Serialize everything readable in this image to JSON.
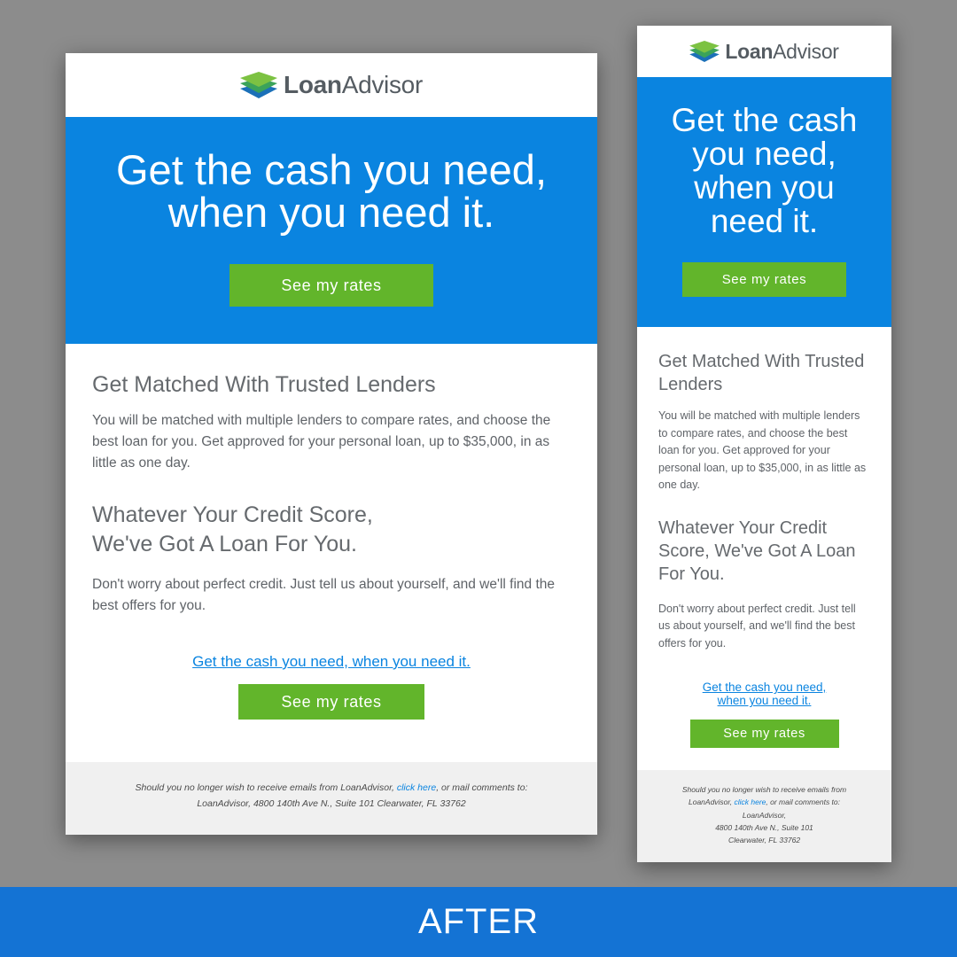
{
  "brand": {
    "logo_bold": "Loan",
    "logo_regular": "Advisor",
    "colors": {
      "primary_blue": "#0a84e0",
      "button_green": "#62b52b",
      "logo_dark": "#1b70b8",
      "logo_light": "#7cc242",
      "footer_bg": "#f0f0f0",
      "banner_blue": "#1473d4"
    }
  },
  "hero": {
    "title": "Get the cash you need, when you need it.",
    "button_label": "See my rates"
  },
  "sections": {
    "lenders_title": "Get Matched With Trusted Lenders",
    "lenders_text": "You will be matched with multiple lenders to compare rates, and choose the best loan for you. Get approved for your personal loan, up to $35,000, in as little as one day.",
    "credit_title_line1": "Whatever Your Credit Score,",
    "credit_title_line2": "We've Got A Loan For You.",
    "credit_title": "Whatever Your Credit Score, We've Got A Loan For You.",
    "credit_text": "Don't worry about perfect credit. Just tell us about yourself, and we'll find the best offers for you."
  },
  "cta": {
    "link_text": "Get the cash you need, when you need it.",
    "button_label": "See my rates"
  },
  "footer": {
    "text_before_link": "Should you no longer wish to receive emails from LoanAdvisor, ",
    "link_text": "click here",
    "text_after_link": ", or mail comments to:",
    "address": "LoanAdvisor, 4800 140th Ave N., Suite 101 Clearwater, FL 33762",
    "mobile_line1": "Should you no longer wish to receive emails from",
    "mobile_line2_before": "LoanAdvisor, ",
    "mobile_line2_after": ", or mail comments to:",
    "mobile_line3": "LoanAdvisor,",
    "mobile_line4": "4800 140th Ave N., Suite 101",
    "mobile_line5": "Clearwater, FL 33762"
  },
  "banner": {
    "label": "AFTER"
  }
}
